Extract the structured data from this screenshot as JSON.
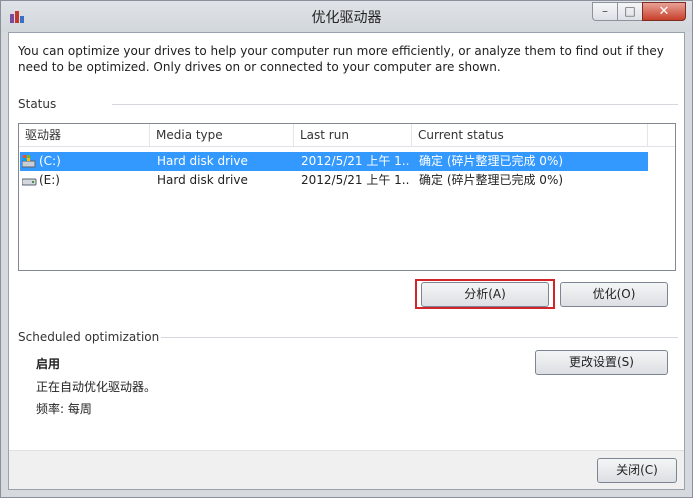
{
  "window": {
    "title": "优化驱动器",
    "min_glyph": "–",
    "max_glyph": "□",
    "close_glyph": "✕"
  },
  "description": "You can optimize your drives to help your computer run more efficiently, or analyze them to find out if they need to be optimized. Only drives on or connected to your computer are shown.",
  "status": {
    "label": "Status",
    "columns": [
      "驱动器",
      "Media type",
      "Last run",
      "Current status"
    ],
    "rows": [
      {
        "drive": "(C:)",
        "media": "Hard disk drive",
        "last_run": "2012/5/21 上午 1...",
        "status": "确定 (碎片整理已完成 0%)",
        "icon": "system-drive-icon",
        "selected": true
      },
      {
        "drive": "(E:)",
        "media": "Hard disk drive",
        "last_run": "2012/5/21 上午 1...",
        "status": "确定 (碎片整理已完成 0%)",
        "icon": "hard-drive-icon",
        "selected": false
      }
    ]
  },
  "buttons": {
    "analyze": "分析(A)",
    "optimize": "优化(O)",
    "change_settings": "更改设置(S)",
    "close": "关闭(C)"
  },
  "scheduled": {
    "label": "Scheduled optimization",
    "state": "启用",
    "detail": "正在自动优化驱动器。",
    "frequency": "频率: 每周"
  },
  "colors": {
    "selection": "#3399ff",
    "highlight_box": "#d0262b"
  }
}
